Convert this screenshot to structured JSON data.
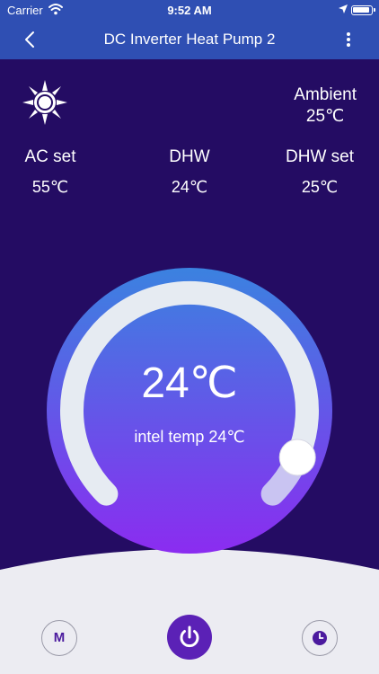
{
  "status_bar": {
    "carrier": "Carrier",
    "time": "9:52 AM"
  },
  "nav": {
    "title": "DC Inverter Heat Pump 2",
    "back_icon": "chevron-left-icon",
    "menu_icon": "more-vertical-icon"
  },
  "ambient": {
    "label": "Ambient",
    "value": "25℃"
  },
  "mode_icon": "sun-icon",
  "readings": [
    {
      "label": "AC set",
      "value": "55℃"
    },
    {
      "label": "DHW",
      "value": "24℃"
    },
    {
      "label": "DHW set",
      "value": "25℃"
    }
  ],
  "dial": {
    "temperature": "24℃",
    "inlet_text": "intel temp 24℃",
    "level": 0.92
  },
  "controls": {
    "mode_label": "M",
    "power_icon": "power-icon",
    "timer_icon": "clock-icon"
  },
  "colors": {
    "header": "#2f4fb3",
    "background": "#240c63",
    "dial_top": "#3b82e0",
    "dial_bottom": "#8b2cf0",
    "accent": "#5b21b6"
  }
}
